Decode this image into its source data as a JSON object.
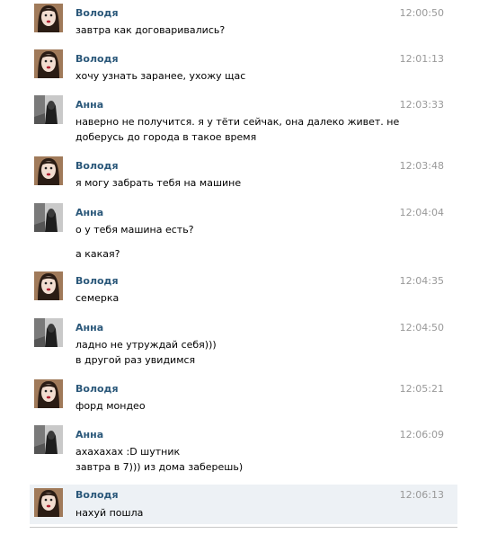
{
  "colors": {
    "name": "#2b587a",
    "time": "#999999",
    "highlight": "#edf1f5"
  },
  "messages": [
    {
      "author": "Володя",
      "time": "12:00:50",
      "avatar": "volodya-avatar-icon",
      "lines": [
        "завтра как договаривались?"
      ]
    },
    {
      "author": "Володя",
      "time": "12:01:13",
      "avatar": "volodya-avatar-icon",
      "lines": [
        "хочу узнать заранее, ухожу щас"
      ]
    },
    {
      "author": "Анна",
      "time": "12:03:33",
      "avatar": "anna-avatar-icon",
      "lines": [
        "наверно не получится. я у тёти сейчак, она далеко живет. не",
        "доберусь до города в такое время"
      ]
    },
    {
      "author": "Володя",
      "time": "12:03:48",
      "avatar": "volodya-avatar-icon",
      "lines": [
        "я могу забрать тебя на машине"
      ]
    },
    {
      "author": "Анна",
      "time": "12:04:04",
      "avatar": "anna-avatar-icon",
      "lines": [
        "о у тебя машина есть?",
        "а какая?"
      ]
    },
    {
      "author": "Володя",
      "time": "12:04:35",
      "avatar": "volodya-avatar-icon",
      "lines": [
        "семерка"
      ]
    },
    {
      "author": "Анна",
      "time": "12:04:50",
      "avatar": "anna-avatar-icon",
      "lines": [
        "ладно не утруждай себя)))",
        "в другой раз увидимся"
      ]
    },
    {
      "author": "Володя",
      "time": "12:05:21",
      "avatar": "volodya-avatar-icon",
      "lines": [
        "форд мондео"
      ]
    },
    {
      "author": "Анна",
      "time": "12:06:09",
      "avatar": "anna-avatar-icon",
      "lines": [
        "ахахахах :D шутник",
        "завтра в 7))) из дома заберешь)"
      ]
    },
    {
      "author": "Володя",
      "time": "12:06:13",
      "avatar": "volodya-avatar-icon",
      "lines": [
        "нахуй пошла"
      ]
    }
  ]
}
